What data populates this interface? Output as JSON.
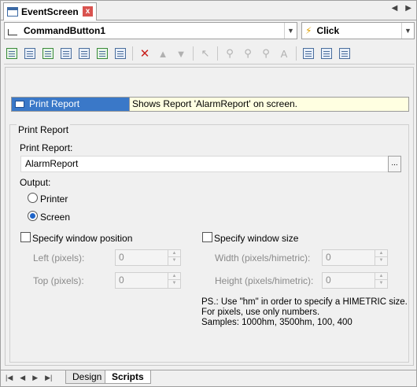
{
  "tab": {
    "title": "EventScreen",
    "close": "x"
  },
  "nav": {
    "prev": "◀",
    "next": "▶"
  },
  "object_select": {
    "value": "CommandButton1"
  },
  "event_select": {
    "value": "Click"
  },
  "action": {
    "name": "Print Report",
    "description": "Shows Report 'AlarmReport' on screen."
  },
  "group": {
    "title": "Print Report",
    "report_label": "Print Report:",
    "report_value": "AlarmReport",
    "browse": "...",
    "output_label": "Output:",
    "printer_label": "Printer",
    "screen_label": "Screen",
    "win_pos_label": "Specify window position",
    "win_size_label": "Specify window size",
    "left_label": "Left (pixels):",
    "left_value": "0",
    "top_label": "Top (pixels):",
    "top_value": "0",
    "width_label": "Width (pixels/himetric):",
    "width_value": "0",
    "height_label": "Height (pixels/himetric):",
    "height_value": "0",
    "note_line1": "PS.: Use \"hm\" in order to specify a HIMETRIC size.",
    "note_line2": "For pixels, use only numbers.",
    "note_line3": "Samples: 1000hm, 3500hm, 100, 400"
  },
  "bottom_tabs": {
    "design": "Design",
    "scripts": "Scripts"
  },
  "bottom_nav": {
    "first": "|◀",
    "prev": "◀",
    "next": "▶",
    "last": "▶|"
  }
}
